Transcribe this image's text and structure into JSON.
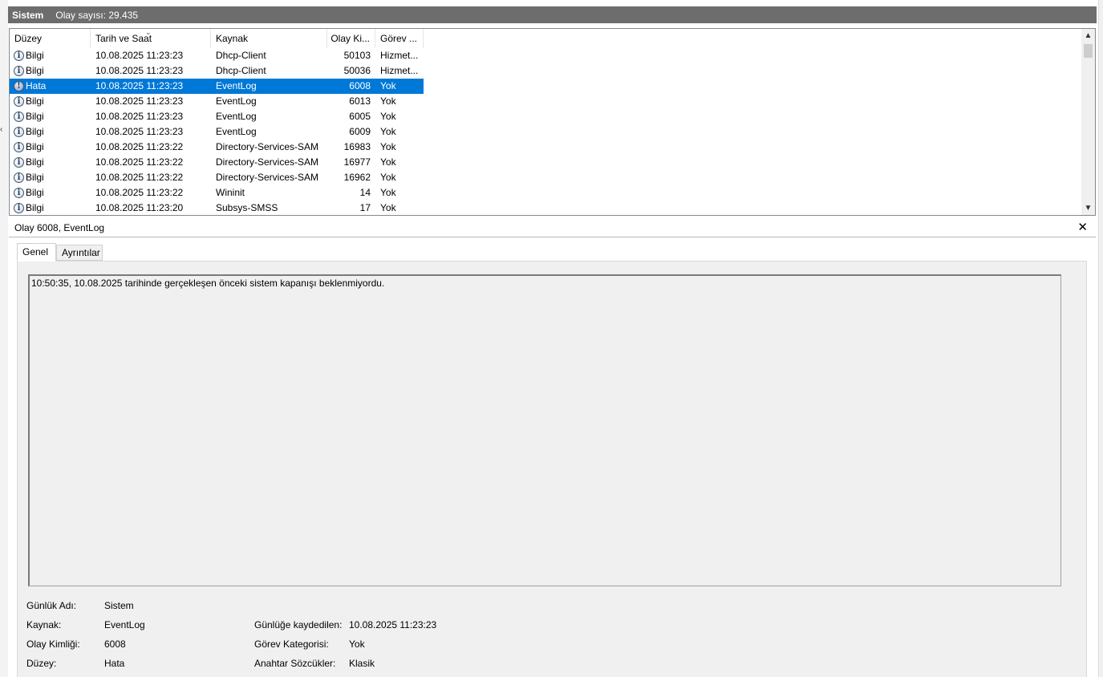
{
  "header": {
    "log_name": "Sistem",
    "event_count": "Olay sayısı: 29.435"
  },
  "columns": {
    "level": "Düzey",
    "datetime": "Tarih ve Saat",
    "source": "Kaynak",
    "event_id": "Olay Ki...",
    "task": "Görev ..."
  },
  "rows": [
    {
      "level": "Bilgi",
      "datetime": "10.08.2025 11:23:23",
      "source": "Dhcp-Client",
      "event_id": "50103",
      "task": "Hizmet...",
      "icon": "info-icon"
    },
    {
      "level": "Bilgi",
      "datetime": "10.08.2025 11:23:23",
      "source": "Dhcp-Client",
      "event_id": "50036",
      "task": "Hizmet...",
      "icon": "info-icon"
    },
    {
      "level": "Hata",
      "datetime": "10.08.2025 11:23:23",
      "source": "EventLog",
      "event_id": "6008",
      "task": "Yok",
      "icon": "error-icon"
    },
    {
      "level": "Bilgi",
      "datetime": "10.08.2025 11:23:23",
      "source": "EventLog",
      "event_id": "6013",
      "task": "Yok",
      "icon": "info-icon"
    },
    {
      "level": "Bilgi",
      "datetime": "10.08.2025 11:23:23",
      "source": "EventLog",
      "event_id": "6005",
      "task": "Yok",
      "icon": "info-icon"
    },
    {
      "level": "Bilgi",
      "datetime": "10.08.2025 11:23:23",
      "source": "EventLog",
      "event_id": "6009",
      "task": "Yok",
      "icon": "info-icon"
    },
    {
      "level": "Bilgi",
      "datetime": "10.08.2025 11:23:22",
      "source": "Directory-Services-SAM",
      "event_id": "16983",
      "task": "Yok",
      "icon": "info-icon"
    },
    {
      "level": "Bilgi",
      "datetime": "10.08.2025 11:23:22",
      "source": "Directory-Services-SAM",
      "event_id": "16977",
      "task": "Yok",
      "icon": "info-icon"
    },
    {
      "level": "Bilgi",
      "datetime": "10.08.2025 11:23:22",
      "source": "Directory-Services-SAM",
      "event_id": "16962",
      "task": "Yok",
      "icon": "info-icon"
    },
    {
      "level": "Bilgi",
      "datetime": "10.08.2025 11:23:22",
      "source": "Wininit",
      "event_id": "14",
      "task": "Yok",
      "icon": "info-icon"
    },
    {
      "level": "Bilgi",
      "datetime": "10.08.2025 11:23:20",
      "source": "Subsys-SMSS",
      "event_id": "17",
      "task": "Yok",
      "icon": "info-icon"
    }
  ],
  "detail": {
    "title": "Olay 6008, EventLog",
    "tabs": {
      "general": "Genel",
      "details": "Ayrıntılar"
    },
    "description": "10:50:35, 10.08.2025 tarihinde gerçekleşen önceki sistem kapanışı beklenmiyordu.",
    "fields": {
      "log_name_label": "Günlük Adı:",
      "log_name_value": "Sistem",
      "source_label": "Kaynak:",
      "source_value": "EventLog",
      "logged_label": "Günlüğe kaydedilen:",
      "logged_value": "10.08.2025 11:23:23",
      "event_id_label": "Olay Kimliği:",
      "event_id_value": "6008",
      "task_label": "Görev Kategorisi:",
      "task_value": "Yok",
      "level_label": "Düzey:",
      "level_value": "Hata",
      "keywords_label": "Anahtar Sözcükler:",
      "keywords_value": "Klasik"
    }
  },
  "colors": {
    "selection": "#0078d7",
    "titlebar": "#6d6d6d"
  }
}
